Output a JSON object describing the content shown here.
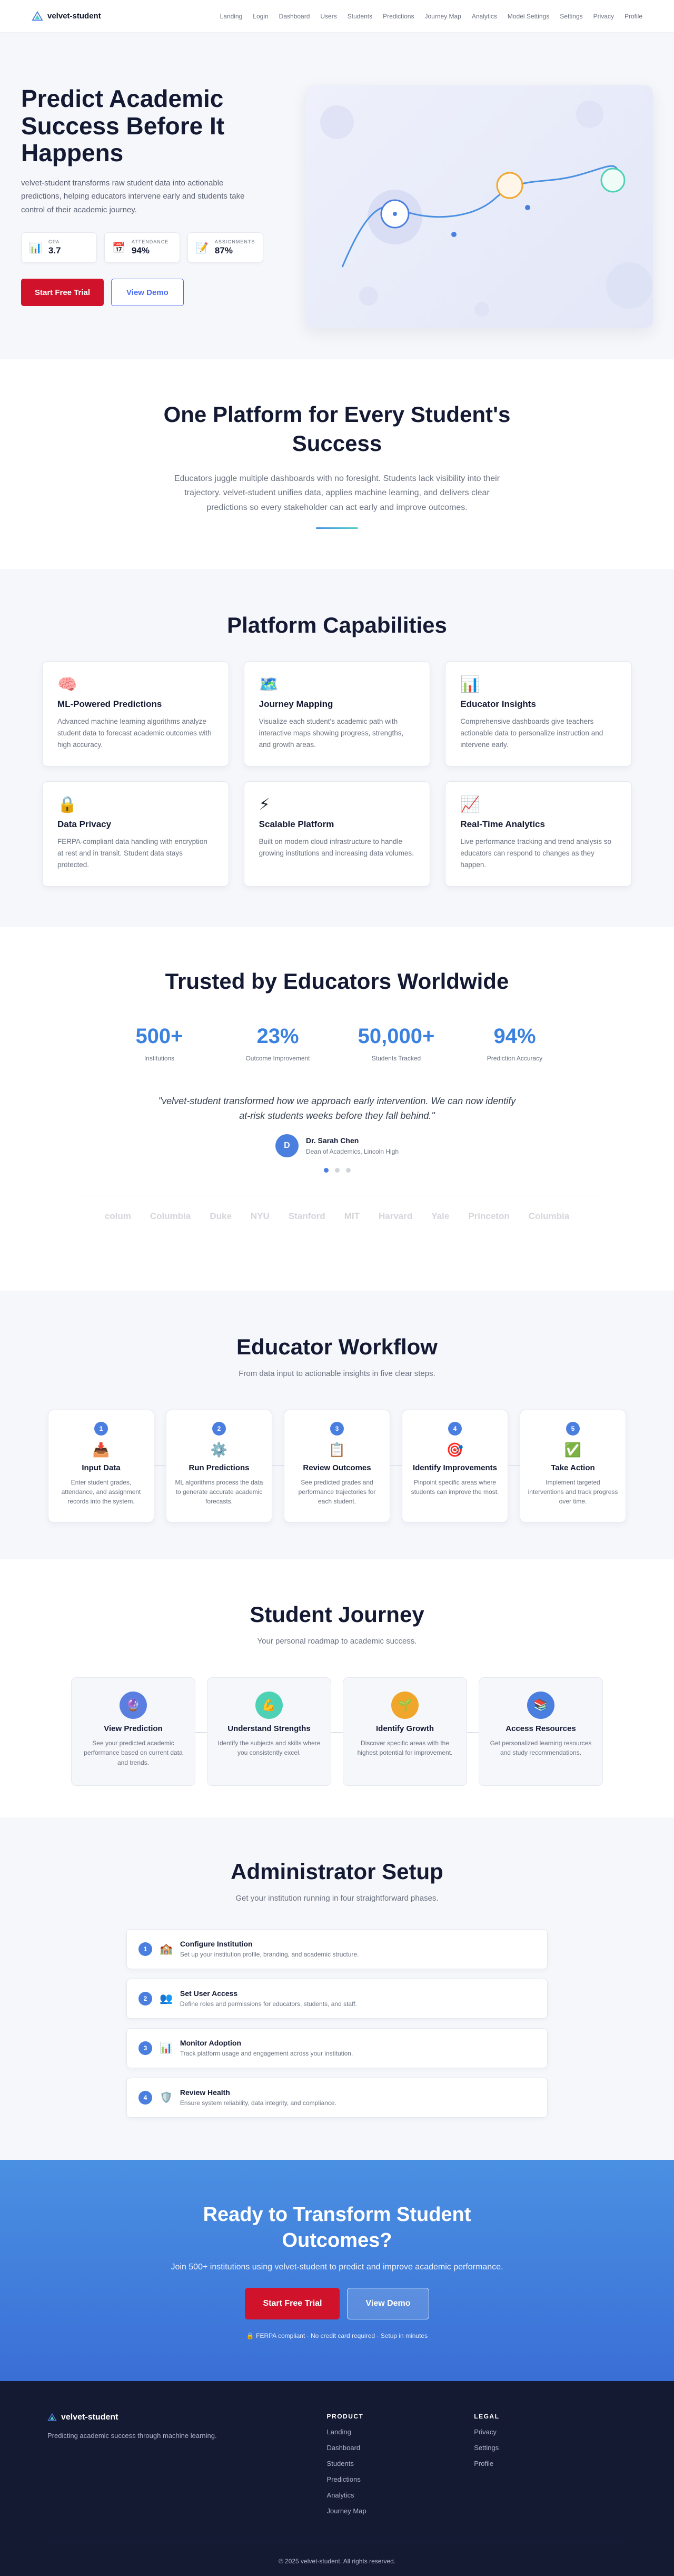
{
  "brand": {
    "name": "velvet-student"
  },
  "nav": {
    "links": [
      "Landing",
      "Login",
      "Dashboard",
      "Users",
      "Students",
      "Predictions",
      "Journey Map",
      "Analytics",
      "Model Settings",
      "Settings",
      "Privacy",
      "Profile"
    ]
  },
  "hero": {
    "title": "Predict Academic Success Before It Happens",
    "subtitle": "velvet-student transforms raw student data into actionable predictions, helping educators intervene early and students take control of their academic journey.",
    "stats": [
      {
        "icon": "chart-icon",
        "glyph": "📊",
        "label": "GPA",
        "value": "3.7"
      },
      {
        "icon": "calendar-icon",
        "glyph": "📅",
        "label": "ATTENDANCE",
        "value": "94%"
      },
      {
        "icon": "memo-icon",
        "glyph": "📝",
        "label": "ASSIGNMENTS",
        "value": "87%"
      }
    ],
    "primary_cta": "Start Free Trial",
    "secondary_cta": "View Demo"
  },
  "unified": {
    "title": "One Platform for Every Student's Success",
    "body": "Educators juggle multiple dashboards with no foresight. Students lack visibility into their trajectory. velvet-student unifies data, applies machine learning, and delivers clear predictions so every stakeholder can act early and improve outcomes."
  },
  "capabilities": {
    "title": "Platform Capabilities",
    "items": [
      {
        "icon": "brain-icon",
        "glyph": "🧠",
        "title": "ML-Powered Predictions",
        "desc": "Advanced machine learning algorithms analyze student data to forecast academic outcomes with high accuracy."
      },
      {
        "icon": "map-icon",
        "glyph": "🗺️",
        "title": "Journey Mapping",
        "desc": "Visualize each student's academic path with interactive maps showing progress, strengths, and growth areas."
      },
      {
        "icon": "chart-icon",
        "glyph": "📊",
        "title": "Educator Insights",
        "desc": "Comprehensive dashboards give teachers actionable data to personalize instruction and intervene early."
      },
      {
        "icon": "lock-icon",
        "glyph": "🔒",
        "title": "Data Privacy",
        "desc": "FERPA-compliant data handling with encryption at rest and in transit. Student data stays protected."
      },
      {
        "icon": "lightning-icon",
        "glyph": "⚡",
        "title": "Scalable Platform",
        "desc": "Built on modern cloud infrastructure to handle growing institutions and increasing data volumes."
      },
      {
        "icon": "trend-icon",
        "glyph": "📈",
        "title": "Real-Time Analytics",
        "desc": "Live performance tracking and trend analysis so educators can respond to changes as they happen."
      }
    ]
  },
  "trusted": {
    "title": "Trusted by Educators Worldwide",
    "metrics": [
      {
        "value": "500+",
        "label": "Institutions"
      },
      {
        "value": "23%",
        "label": "Outcome Improvement"
      },
      {
        "value": "50,000+",
        "label": "Students Tracked"
      },
      {
        "value": "94%",
        "label": "Prediction Accuracy"
      }
    ],
    "quote": "\"velvet-student transformed how we approach early intervention. We can now identify at-risk students weeks before they fall behind.\"",
    "author": {
      "initial": "D",
      "name": "Dr. Sarah Chen",
      "role": "Dean of Academics, Lincoln High"
    },
    "logos": [
      "colum",
      "Columbia",
      "Duke",
      "NYU",
      "Stanford",
      "MIT",
      "Harvard",
      "Yale",
      "Princeton",
      "Columbia"
    ]
  },
  "workflow": {
    "title": "Educator Workflow",
    "subtitle": "From data input to actionable insights in five clear steps.",
    "steps": [
      {
        "num": "1",
        "icon": "inbox-icon",
        "glyph": "📥",
        "title": "Input Data",
        "desc": "Enter student grades, attendance, and assignment records into the system."
      },
      {
        "num": "2",
        "icon": "gear-icon",
        "glyph": "⚙️",
        "title": "Run Predictions",
        "desc": "ML algorithms process the data to generate accurate academic forecasts."
      },
      {
        "num": "3",
        "icon": "clipboard-icon",
        "glyph": "📋",
        "title": "Review Outcomes",
        "desc": "See predicted grades and performance trajectories for each student."
      },
      {
        "num": "4",
        "icon": "target-icon",
        "glyph": "🎯",
        "title": "Identify Improvements",
        "desc": "Pinpoint specific areas where students can improve the most."
      },
      {
        "num": "5",
        "icon": "check-icon",
        "glyph": "✅",
        "title": "Take Action",
        "desc": "Implement targeted interventions and track progress over time."
      }
    ]
  },
  "journey": {
    "title": "Student Journey",
    "subtitle": "Your personal roadmap to academic success.",
    "steps": [
      {
        "icon": "crystal-ball-icon",
        "glyph": "🔮",
        "color": "#5b7fe0",
        "title": "View Prediction",
        "desc": "See your predicted academic performance based on current data and trends."
      },
      {
        "icon": "muscle-icon",
        "glyph": "💪",
        "color": "#4fd1b5",
        "title": "Understand Strengths",
        "desc": "Identify the subjects and skills where you consistently excel."
      },
      {
        "icon": "seedling-icon",
        "glyph": "🌱",
        "color": "#f0a62a",
        "title": "Identify Growth",
        "desc": "Discover specific areas with the highest potential for improvement."
      },
      {
        "icon": "books-icon",
        "glyph": "📚",
        "color": "#4a7fe0",
        "title": "Access Resources",
        "desc": "Get personalized learning resources and study recommendations."
      }
    ]
  },
  "admin": {
    "title": "Administrator Setup",
    "subtitle": "Get your institution running in four straightforward phases.",
    "steps": [
      {
        "num": "1",
        "icon": "school-icon",
        "glyph": "🏫",
        "title": "Configure Institution",
        "desc": "Set up your institution profile, branding, and academic structure."
      },
      {
        "num": "2",
        "icon": "users-icon",
        "glyph": "👥",
        "title": "Set User Access",
        "desc": "Define roles and permissions for educators, students, and staff."
      },
      {
        "num": "3",
        "icon": "chart-icon",
        "glyph": "📊",
        "title": "Monitor Adoption",
        "desc": "Track platform usage and engagement across your institution."
      },
      {
        "num": "4",
        "icon": "shield-icon",
        "glyph": "🛡️",
        "title": "Review Health",
        "desc": "Ensure system reliability, data integrity, and compliance."
      }
    ]
  },
  "cta": {
    "title": "Ready to Transform Student Outcomes?",
    "subtitle": "Join 500+ institutions using velvet-student to predict and improve academic performance.",
    "primary": "Start Free Trial",
    "secondary": "View Demo",
    "note": "🔒 FERPA compliant · No credit card required · Setup in minutes"
  },
  "footer": {
    "tagline": "Predicting academic success through machine learning.",
    "product_heading": "PRODUCT",
    "product_links": [
      "Landing",
      "Dashboard",
      "Students",
      "Predictions",
      "Analytics",
      "Journey Map"
    ],
    "legal_heading": "LEGAL",
    "legal_links": [
      "Privacy",
      "Settings",
      "Profile"
    ],
    "copyright": "© 2025 velvet-student. All rights reserved."
  },
  "colors": {
    "accent": "#4a7fe0",
    "primary_red": "#d0122b",
    "dark": "#151a33"
  }
}
